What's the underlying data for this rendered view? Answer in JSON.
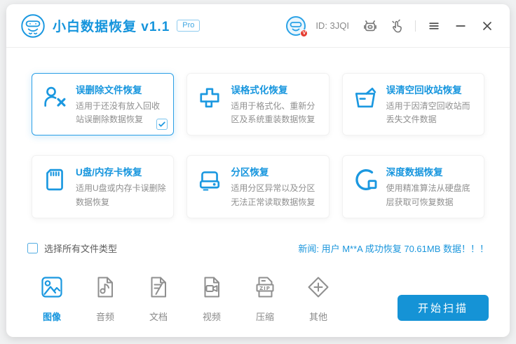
{
  "header": {
    "title": "小白数据恢复",
    "version": "v1.1",
    "pro_badge": "Pro",
    "user_id": "ID: 3JQI",
    "avatar_badge": "V",
    "icons": [
      "logo-robot-icon",
      "avatar-icon",
      "robot-icon",
      "hand-click-icon",
      "menu-icon",
      "minimize-icon",
      "close-icon"
    ]
  },
  "cards": [
    {
      "title": "误删除文件恢复",
      "desc": "适用于还没有放入回收站误删除数据恢复",
      "icon": "user-x-icon",
      "selected": true
    },
    {
      "title": "误格式化恢复",
      "desc": "适用于格式化、重新分区及系统重装数据恢复",
      "icon": "format-brush-icon",
      "selected": false
    },
    {
      "title": "误清空回收站恢复",
      "desc": "适用于因清空回收站而丢失文件数据",
      "icon": "recycle-bin-icon",
      "selected": false
    },
    {
      "title": "U盘/内存卡恢复",
      "desc": "适用U盘或内存卡误删除数据恢复",
      "icon": "sd-card-icon",
      "selected": false
    },
    {
      "title": "分区恢复",
      "desc": "适用分区异常以及分区无法正常读取数据恢复",
      "icon": "hard-drive-icon",
      "selected": false
    },
    {
      "title": "深度数据恢复",
      "desc": "使用精准算法从硬盘底层获取可恢复数据",
      "icon": "deep-scan-icon",
      "selected": false
    }
  ],
  "filetypes": {
    "select_all": "选择所有文件类型",
    "select_all_checked": false,
    "zip_glyph": "ZIP",
    "items": [
      {
        "label": "图像",
        "icon": "image-icon",
        "selected": true
      },
      {
        "label": "音频",
        "icon": "audio-file-icon",
        "selected": false
      },
      {
        "label": "文档",
        "icon": "document-file-icon",
        "selected": false
      },
      {
        "label": "视频",
        "icon": "video-file-icon",
        "selected": false
      },
      {
        "label": "压缩",
        "icon": "zip-file-icon",
        "selected": false
      },
      {
        "label": "其他",
        "icon": "other-diamond-icon",
        "selected": false
      }
    ]
  },
  "news": {
    "text": "新闻: 用户 M**A 成功恢复 70.61MB 数据！！！"
  },
  "scan": {
    "label": "开始扫描"
  },
  "colors": {
    "accent": "#1796de",
    "button": "#1593d6",
    "news": "#1b96dc",
    "badge_red": "#e53b30"
  }
}
